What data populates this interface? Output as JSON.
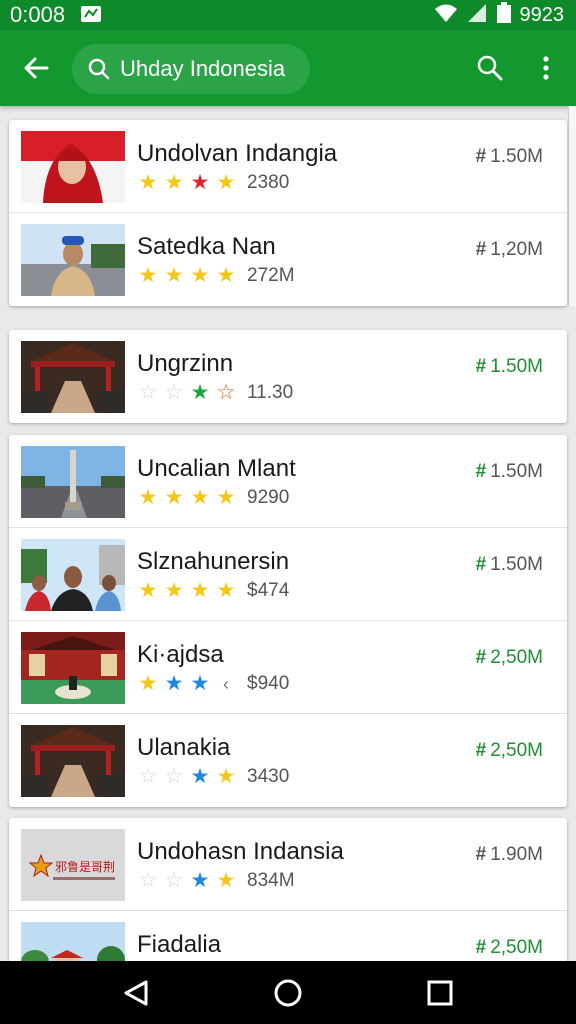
{
  "status_bar": {
    "time": "0:008",
    "battery_text": "9923"
  },
  "app_bar": {
    "search_text": "Uhday Indonesia"
  },
  "colors": {
    "status_bar": "#0f8a2b",
    "app_bar": "#13982f",
    "search_pill": "#2aa447",
    "size_gray": "#555555",
    "size_green": "#1e8f33"
  },
  "cards": [
    {
      "rows": [
        {
          "title": "Undolvan Indangia",
          "count": "2380",
          "size": "1.50M",
          "size_color": "gray",
          "thumb": "woman-red-hijab",
          "stars": [
            "yellow",
            "yellow",
            "red",
            "yellow"
          ]
        },
        {
          "title": "Satedka Nan",
          "count": "272M",
          "size": "1,20M",
          "size_color": "gray",
          "thumb": "man-blue-cap",
          "stars": [
            "yellow",
            "yellow",
            "yellow",
            "yellow"
          ]
        }
      ]
    },
    {
      "rows": [
        {
          "title": "Ungrzinn",
          "count": "11.30",
          "size": "1.50M",
          "size_color": "green",
          "thumb": "pavilion-path",
          "stars": [
            "empty",
            "empty",
            "green",
            "orange-outline"
          ]
        }
      ]
    },
    {
      "rows": [
        {
          "title": "Uncalian Mlant",
          "count": "9290",
          "size": "1.50M",
          "size_color": "gray",
          "thumb": "monument-road",
          "stars": [
            "yellow",
            "yellow",
            "yellow",
            "yellow"
          ]
        },
        {
          "title": "Slznahunersin",
          "count": "$474",
          "size": "1.50M",
          "size_color": "gray",
          "thumb": "group-people",
          "stars": [
            "yellow",
            "yellow",
            "yellow",
            "yellow"
          ]
        },
        {
          "title": "Ki·ajdsa",
          "count": "$940",
          "size": "2,50M",
          "size_color": "green",
          "thumb": "red-hall",
          "stars": [
            "yellow",
            "blue",
            "blue",
            "chevron"
          ]
        },
        {
          "title": "Ulanakia",
          "count": "3430",
          "size": "2,50M",
          "size_color": "green",
          "thumb": "pavilion-path",
          "stars": [
            "empty",
            "empty",
            "blue",
            "yellow"
          ]
        }
      ]
    },
    {
      "rows": [
        {
          "title": "Undohasn Indansia",
          "count": "834M",
          "size": "1.90M",
          "size_color": "gray",
          "thumb": "logo",
          "logo_text": "邪鲁是哥荆",
          "stars": [
            "empty",
            "empty",
            "blue",
            "yellow"
          ]
        },
        {
          "title": "Fiadalia",
          "count": "",
          "size": "2,50M",
          "size_color": "green",
          "thumb": "park",
          "stars": []
        }
      ]
    }
  ]
}
